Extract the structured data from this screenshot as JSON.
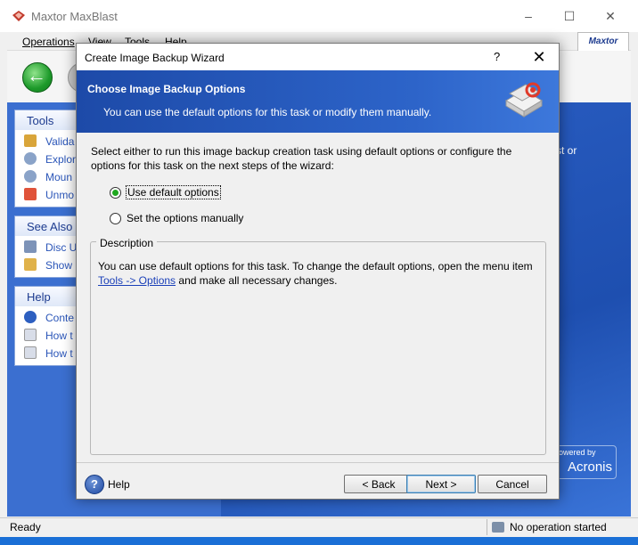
{
  "app": {
    "title": "Maxtor MaxBlast",
    "logo_text": "Maxtor",
    "menus": [
      "Operations",
      "View",
      "Tools",
      "Help"
    ]
  },
  "sidebar": {
    "tools": {
      "title": "Tools",
      "items": [
        "Valida",
        "Explor",
        "Moun",
        "Unmo"
      ]
    },
    "see_also": {
      "title": "See Also",
      "items": [
        "Disc U",
        "Show"
      ]
    },
    "help": {
      "title": "Help",
      "items": [
        "Conte",
        "How t",
        "How t"
      ]
    }
  },
  "right_pane": {
    "text": "st or",
    "brand_small": "owered by",
    "brand_big": "Acronis"
  },
  "status": {
    "left": "Ready",
    "right": "No operation started"
  },
  "dialog": {
    "title": "Create Image Backup Wizard",
    "help_glyph": "?",
    "close_glyph": "✕",
    "header_title": "Choose Image Backup Options",
    "header_subtitle": "You can use the default options for this task or modify them manually.",
    "intro": "Select either to run this image backup creation task using default options or configure the options for this task on the next steps of the wizard:",
    "options": {
      "default": {
        "label": "Use default options",
        "selected": true
      },
      "manual": {
        "label": "Set the options manually",
        "selected": false
      }
    },
    "description": {
      "legend": "Description",
      "text_before": "You can use default options for this task. To change the default options, open the menu item",
      "link": "Tools -> Options",
      "text_after": "and make all necessary changes."
    },
    "help_label": "Help",
    "buttons": {
      "back": "< Back",
      "next": "Next >",
      "cancel": "Cancel"
    }
  },
  "colors": {
    "header_blue": "#2d64c9",
    "radio_green": "#1fa81f",
    "link": "#1a3fb8"
  }
}
